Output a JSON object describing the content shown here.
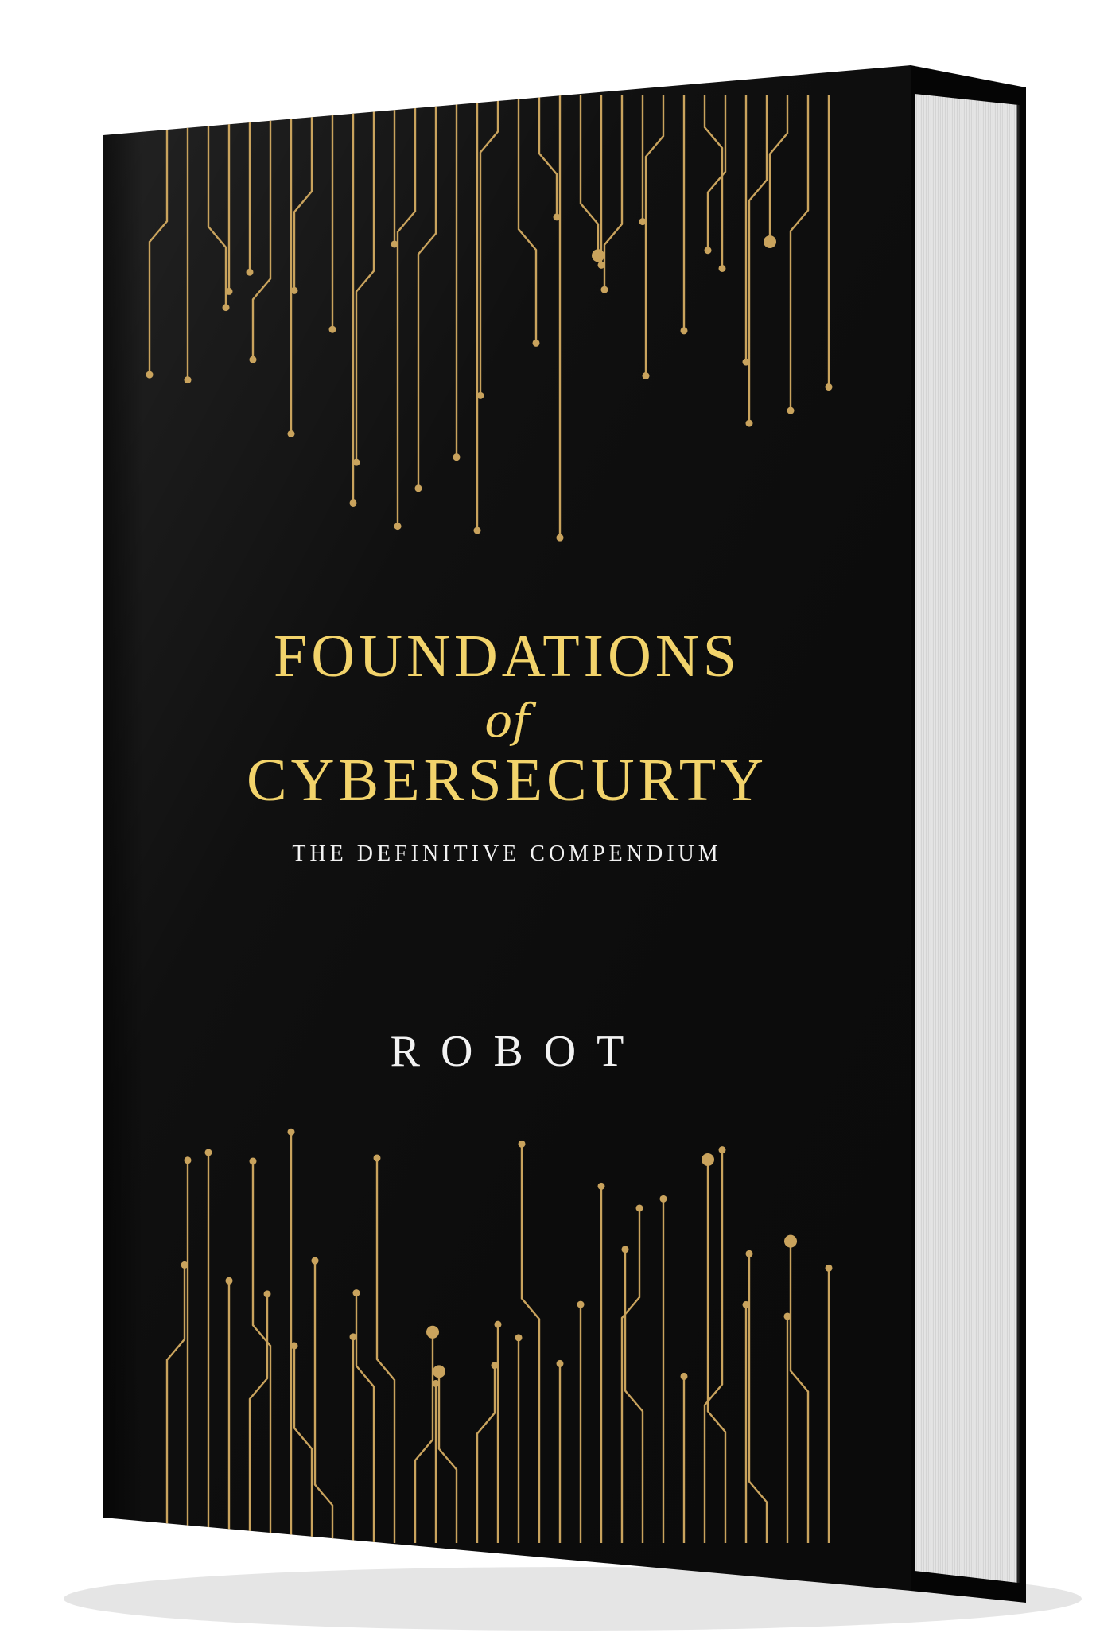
{
  "book": {
    "title_line1": "FOUNDATIONS",
    "title_connector": "of",
    "title_line2": "CYBERSECURTY",
    "subtitle": "THE DEFINITIVE COMPENDIUM",
    "author": "ROBOT"
  },
  "colors": {
    "cover": "#0b0b0b",
    "circuit": "#c9a35d",
    "title": "#f2d36b",
    "text_light": "#f2f2f2",
    "pages": "#e9e9e9"
  },
  "icons": {
    "circuit_pattern": "circuit-trace-pattern-icon"
  }
}
